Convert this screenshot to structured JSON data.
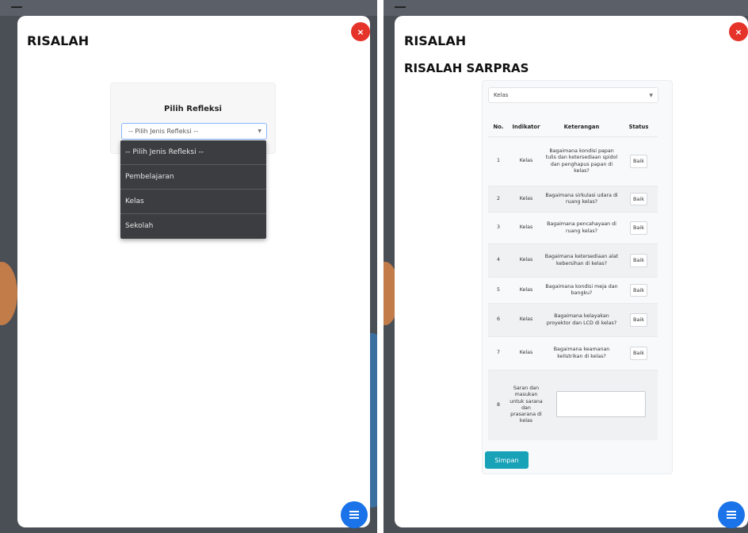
{
  "left": {
    "title": "RISALAH",
    "card_title": "Pilih Refleksi",
    "select_value": "-- Pilih Jenis Refleksi --",
    "dropdown_options": [
      "-- Pilih Jenis Refleksi --",
      "Pembelajaran",
      "Kelas",
      "Sekolah"
    ],
    "close_icon": "×"
  },
  "right": {
    "title": "RISALAH",
    "subtitle": "RISALAH SARPRAS",
    "select_value": "Kelas",
    "close_icon": "×",
    "table": {
      "headers": [
        "No.",
        "Indikator",
        "Keterangan",
        "Status"
      ],
      "rows": [
        {
          "no": "1",
          "indikator": "Kelas",
          "keterangan": "Bagaimana kondisi papan tulis dan ketersediaan spidol dan penghapus papan di kelas?",
          "status": "Baik"
        },
        {
          "no": "2",
          "indikator": "Kelas",
          "keterangan": "Bagaimana sirkulasi udara di ruang kelas?",
          "status": "Baik"
        },
        {
          "no": "3",
          "indikator": "Kelas",
          "keterangan": "Bagaimana pencahayaan di ruang kelas?",
          "status": "Baik"
        },
        {
          "no": "4",
          "indikator": "Kelas",
          "keterangan": "Bagaimana ketersediaan alat kebersihan di kelas?",
          "status": "Baik"
        },
        {
          "no": "5",
          "indikator": "Kelas",
          "keterangan": "Bagaimana kondisi meja dan bangku?",
          "status": "Baik"
        },
        {
          "no": "6",
          "indikator": "Kelas",
          "keterangan": "Bagaimana kelayakan proyektor dan LCD di kelas?",
          "status": "Baik"
        },
        {
          "no": "7",
          "indikator": "Kelas",
          "keterangan": "Bagaimana keamanan kelistrikan di kelas?",
          "status": "Baik"
        },
        {
          "no": "8",
          "indikator": "Saran dan masukan untuk sarana dan prasarana di kelas",
          "keterangan": "",
          "status": ""
        }
      ]
    },
    "save_label": "Simpan"
  },
  "colors": {
    "close": "#e5332a",
    "fab": "#1a73e8",
    "save": "#17a2b8",
    "dropdown_bg": "#3b3d40"
  },
  "icons": {
    "close": "close-icon",
    "fab": "menu-icon"
  }
}
